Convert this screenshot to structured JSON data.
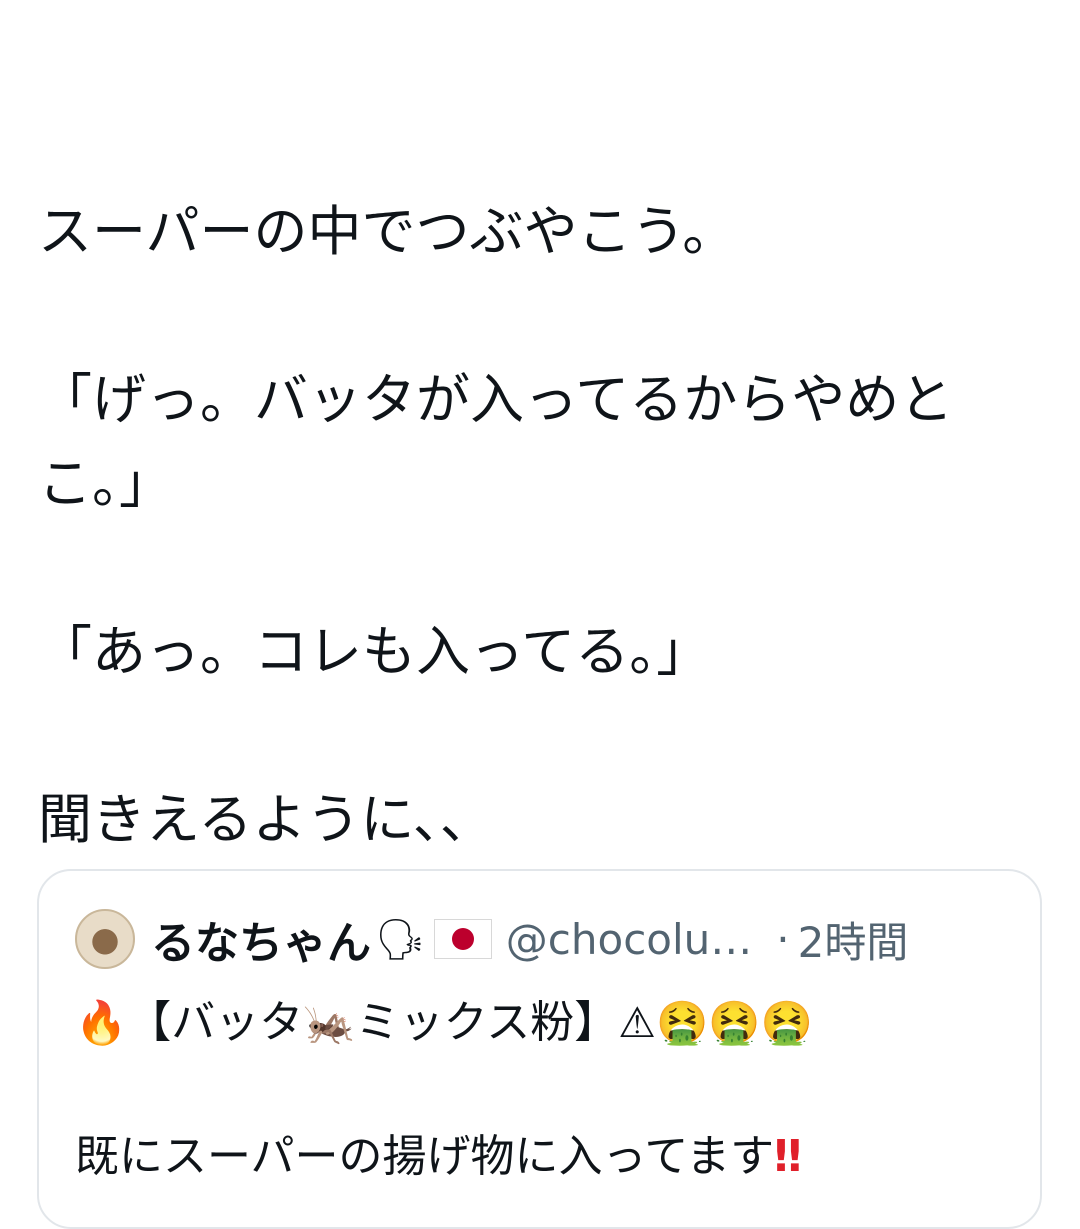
{
  "post": {
    "lines": [
      "スーパーの中でつぶやこう。",
      "",
      "「げっ。バッタが入ってるからやめとこ。」",
      "",
      "「あっ。コレも入ってる。」",
      "",
      "聞きえるように、、"
    ]
  },
  "quote": {
    "display_name": "るなちゃん",
    "name_badges": [
      "🗣",
      "🇯🇵"
    ],
    "handle": "@chocolu…",
    "separator": "·",
    "timestamp": "2時間",
    "line1": {
      "fire_emoji": "🔥",
      "text_a": "【バッタ",
      "cricket_emoji": "🦗",
      "text_b": "ミックス粉】",
      "warning_emoji": "⚠",
      "sick_emojis": "🤮🤮🤮"
    },
    "line3": {
      "text": "既にスーパーの揚げ物に入ってます",
      "bangbang": "‼"
    }
  },
  "colors": {
    "text": "#0f1419",
    "secondary_text": "#536471",
    "card_border": "#e2e6ea",
    "flag_red": "#bc002d",
    "bangbang_red": "#e0202a"
  },
  "icons": [
    "avatar-image",
    "speaking-head-icon",
    "japan-flag-icon",
    "fire-icon",
    "cricket-icon",
    "warning-icon",
    "vomiting-face-icon",
    "double-exclamation-icon"
  ]
}
